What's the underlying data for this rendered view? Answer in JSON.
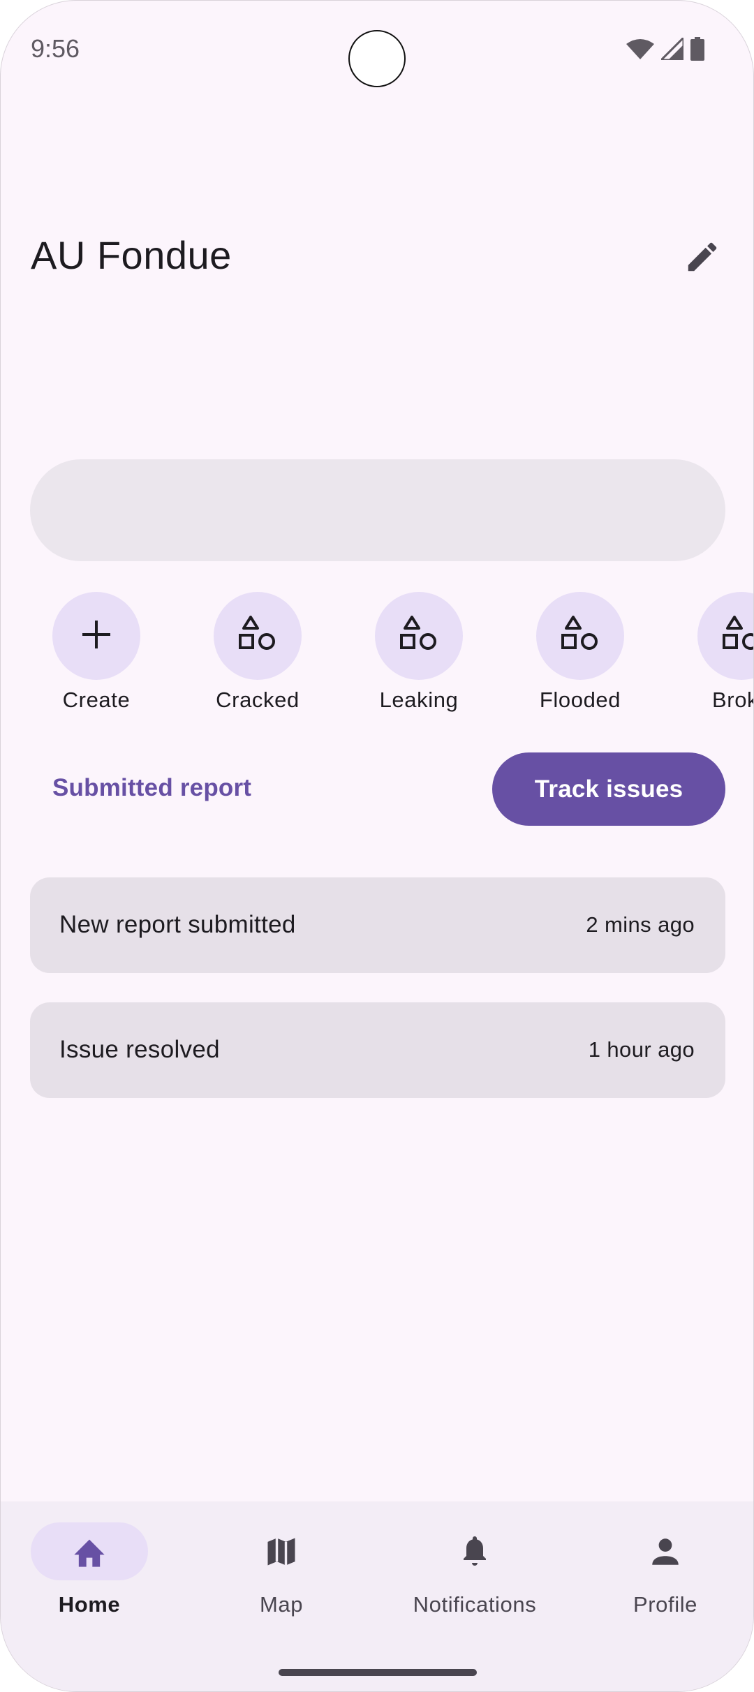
{
  "status_bar": {
    "time": "9:56",
    "icons": [
      "wifi-icon",
      "cellular-signal-icon",
      "battery-icon"
    ]
  },
  "header": {
    "title": "AU Fondue",
    "edit_icon": "pencil-icon"
  },
  "search": {
    "value": ""
  },
  "categories": [
    {
      "label": "Create",
      "icon": "plus-icon"
    },
    {
      "label": "Cracked",
      "icon": "shapes-icon"
    },
    {
      "label": "Leaking",
      "icon": "shapes-icon"
    },
    {
      "label": "Flooded",
      "icon": "shapes-icon"
    },
    {
      "label": "Broke",
      "icon": "shapes-icon"
    }
  ],
  "reports": {
    "submitted_label": "Submitted report",
    "track_label": "Track issues"
  },
  "activity": [
    {
      "text": "New report submitted",
      "time": "2 mins ago"
    },
    {
      "text": "Issue resolved",
      "time": "1 hour ago"
    }
  ],
  "bottom_nav": [
    {
      "label": "Home",
      "icon": "home-icon",
      "active": true
    },
    {
      "label": "Map",
      "icon": "map-icon",
      "active": false
    },
    {
      "label": "Notifications",
      "icon": "bell-icon",
      "active": false
    },
    {
      "label": "Profile",
      "icon": "person-icon",
      "active": false
    }
  ],
  "colors": {
    "background": "#fcf5fc",
    "primary": "#6750a4",
    "chip": "#e8def7",
    "card": "#e6e0e8",
    "nav_bar": "#f3edf6"
  }
}
